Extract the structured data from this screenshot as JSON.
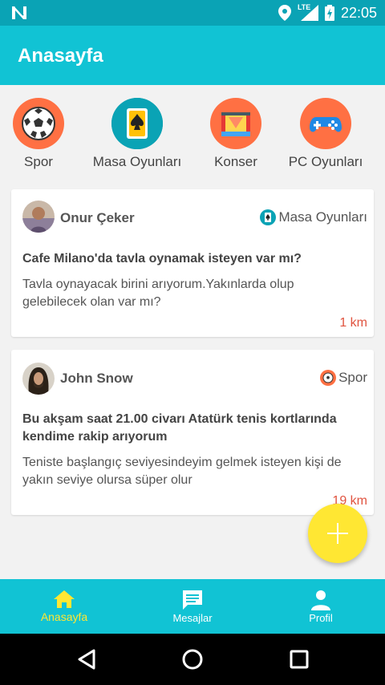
{
  "status_bar": {
    "time": "22:05",
    "network": "LTE",
    "icons": [
      "n-logo-icon",
      "location-icon",
      "signal-icon",
      "battery-charging-icon"
    ]
  },
  "app_bar": {
    "title": "Anasayfa"
  },
  "categories": [
    {
      "label": "Spor",
      "icon": "soccer-ball-icon",
      "color": "#ff7043"
    },
    {
      "label": "Masa Oyunları",
      "icon": "spade-card-icon",
      "color": "#0aa3b5"
    },
    {
      "label": "Konser",
      "icon": "stage-icon",
      "color": "#ff7043"
    },
    {
      "label": "PC Oyunları",
      "icon": "gamepad-icon",
      "color": "#ff7043"
    }
  ],
  "posts": [
    {
      "author": "Onur Çeker",
      "category": "Masa Oyunları",
      "category_icon": "spade-card-icon",
      "title": "Cafe Milano'da tavla oynamak isteyen var mı?",
      "body": "Tavla oynayacak birini arıyorum.Yakınlarda olup gelebilecek olan var mı?",
      "distance": "1 km"
    },
    {
      "author": "John Snow",
      "category": "Spor",
      "category_icon": "soccer-ball-icon",
      "title": "Bu akşam saat 21.00 civarı Atatürk tenis kortlarında kendime rakip arıyorum",
      "body": "Teniste başlangıç seviyesindeyim gelmek isteyen kişi de yakın seviye olursa süper olur",
      "distance": "19 km"
    }
  ],
  "fab": {
    "icon": "plus-icon"
  },
  "bottom_nav": [
    {
      "label": "Anasayfa",
      "icon": "home-icon",
      "active": true
    },
    {
      "label": "Mesajlar",
      "icon": "message-icon",
      "active": false
    },
    {
      "label": "Profil",
      "icon": "person-icon",
      "active": false
    }
  ],
  "colors": {
    "primary": "#11c3d4",
    "status_bar": "#0aa3b5",
    "accent": "#ffe733",
    "distance": "#e0533f",
    "category_orange": "#ff7043"
  }
}
